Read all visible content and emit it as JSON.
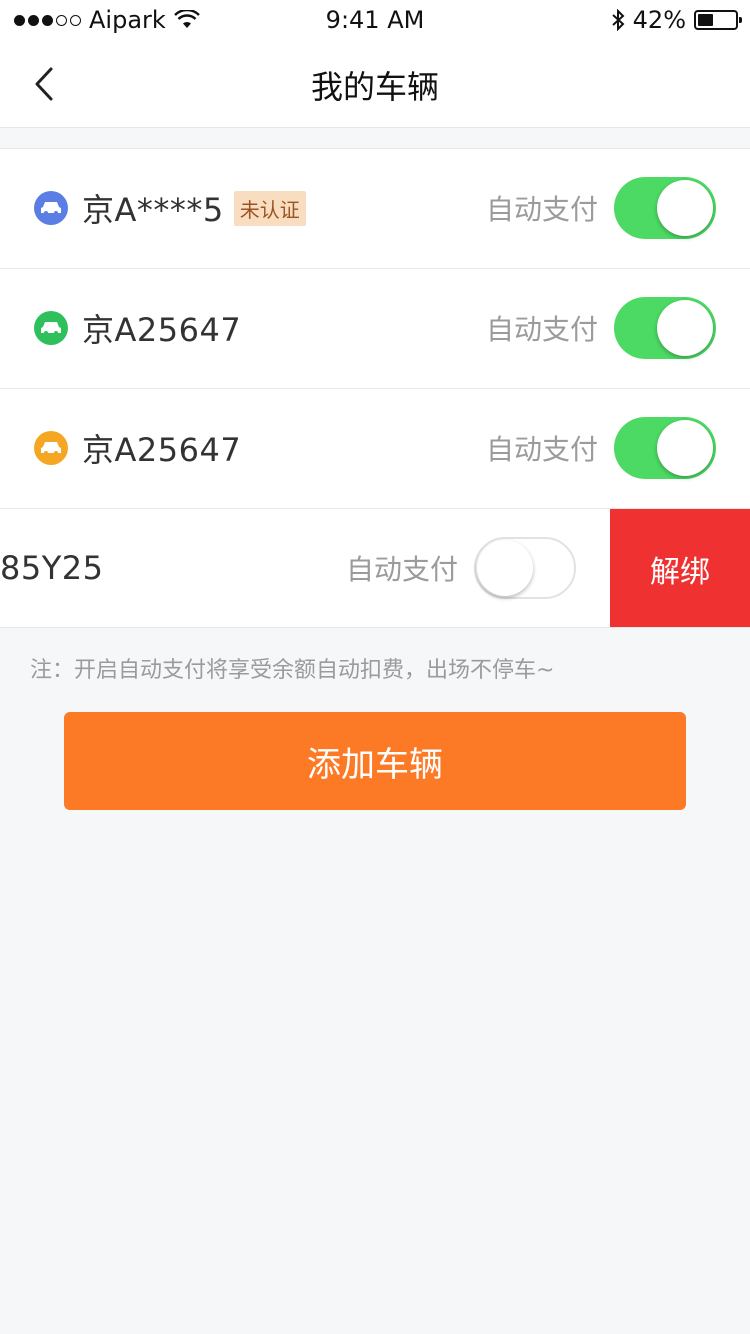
{
  "status_bar": {
    "carrier": "Aipark",
    "time": "9:41 AM",
    "battery": "42%",
    "battery_level": 0.42,
    "signal_bars_filled": 3,
    "signal_bars_total": 5,
    "icons": [
      "wifi-icon",
      "bluetooth-icon",
      "battery-icon"
    ]
  },
  "nav": {
    "title": "我的车辆",
    "back_icon": "chevron-left-icon"
  },
  "vehicles": [
    {
      "plate": "京A****5",
      "badge": "未认证",
      "auto_pay_label": "自动支付",
      "auto_pay_on": true,
      "icon_color": "#5a7ee3"
    },
    {
      "plate": "京A25647",
      "auto_pay_label": "自动支付",
      "auto_pay_on": true,
      "icon_color": "#2ec05a"
    },
    {
      "plate": "京A25647",
      "auto_pay_label": "自动支付",
      "auto_pay_on": true,
      "icon_color": "#f5a623"
    },
    {
      "plate_visible": "85Y25",
      "auto_pay_label": "自动支付",
      "auto_pay_on": false,
      "unbind_label": "解绑"
    }
  ],
  "note": "注：开启自动支付将享受余额自动扣费，出场不停车~",
  "add_button_label": "添加车辆",
  "colors": {
    "accent": "#fc7a26",
    "toggle_on": "#4cd964",
    "unbind": "#f03131",
    "badge_bg": "#f9ddc0",
    "badge_text": "#9a5526"
  }
}
